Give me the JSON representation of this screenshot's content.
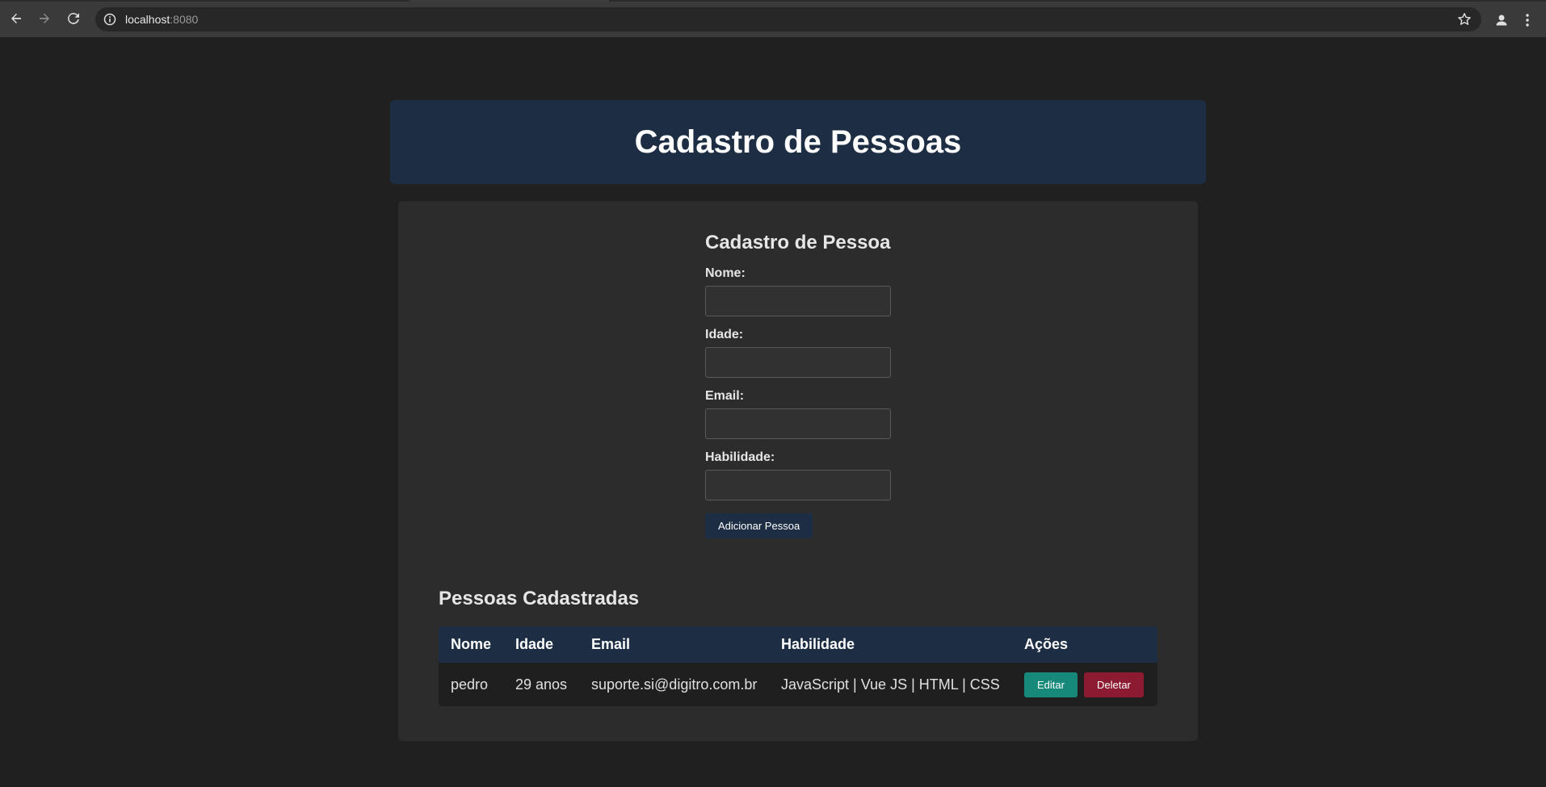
{
  "browser": {
    "url_host": "localhost",
    "url_port": ":8080",
    "icons": [
      "back-icon",
      "forward-icon",
      "reload-icon",
      "info-icon",
      "star-icon",
      "profile-icon",
      "menu-icon"
    ]
  },
  "header": {
    "title": "Cadastro de Pessoas"
  },
  "form": {
    "title": "Cadastro de Pessoa",
    "fields": [
      {
        "label": "Nome:",
        "value": ""
      },
      {
        "label": "Idade:",
        "value": ""
      },
      {
        "label": "Email:",
        "value": ""
      },
      {
        "label": "Habilidade:",
        "value": ""
      }
    ],
    "submit_label": "Adicionar Pessoa"
  },
  "list": {
    "title": "Pessoas Cadastradas",
    "columns": [
      "Nome",
      "Idade",
      "Email",
      "Habilidade",
      "Ações"
    ],
    "rows": [
      {
        "nome": "pedro",
        "idade": "29 anos",
        "email": "suporte.si@digitro.com.br",
        "habilidade": "JavaScript | Vue JS | HTML | CSS",
        "edit_label": "Editar",
        "delete_label": "Deletar"
      }
    ]
  },
  "colors": {
    "page_bg": "#202020",
    "header_bg": "#1d2e44",
    "card_bg": "#2c2c2c",
    "edit_button": "#16897a",
    "delete_button": "#8c1a30"
  }
}
